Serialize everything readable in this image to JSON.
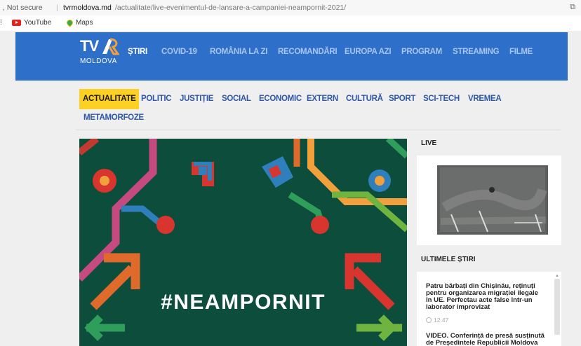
{
  "browser": {
    "security": "Not secure",
    "url_domain": "tvrmoldova.md",
    "url_path": "/actualitate/live-evenimentul-de-lansare-a-campaniei-neampornit-2021/",
    "bookmarks": [
      {
        "label": "YouTube",
        "icon": "youtube-icon"
      },
      {
        "label": "Maps",
        "icon": "maps-pin-icon"
      }
    ]
  },
  "header": {
    "logo_main": "TV",
    "logo_sub": "MOLDOVA",
    "brand_colors": {
      "header_bg": "#2d6fc9",
      "active_tab": "#fdd024"
    },
    "nav": [
      "ȘTIRI",
      "COVID-19",
      "ROMÂNIA LA ZI",
      "RECOMANDĂRI",
      "EUROPA AZI",
      "PROGRAM",
      "STREAMING",
      "FILME"
    ]
  },
  "subnav": [
    "ACTUALITATE",
    "POLITIC",
    "JUSTIȚIE",
    "SOCIAL",
    "ECONOMIC",
    "EXTERN",
    "CULTURĂ",
    "SPORT",
    "SCI-TECH",
    "VREMEA",
    "METAMORFOZE"
  ],
  "hero": {
    "hashtag": "#NEAMPORNIT"
  },
  "sidebar": {
    "live_title": "LIVE",
    "latest_title": "ULTIMELE ȘTIRI",
    "news": [
      {
        "title": "Patru bărbați din Chișinău, reținuți pentru organizarea migrației ilegale în UE. Perfectau acte false într-un laborator improvizat",
        "time": "12:47"
      },
      {
        "title": "VIDEO. Conferință de presă susținută de Președintele Republicii Moldova",
        "time": ""
      }
    ]
  }
}
